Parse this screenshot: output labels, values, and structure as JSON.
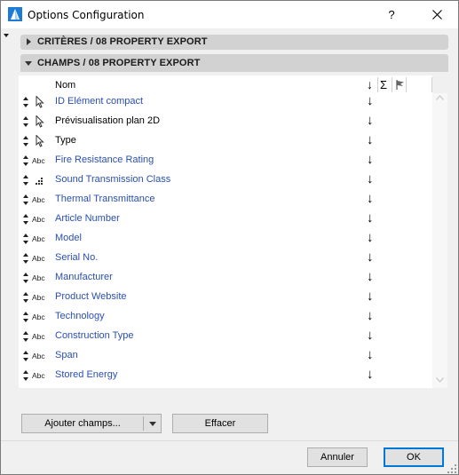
{
  "window": {
    "title": "Options Configuration",
    "help": "?"
  },
  "sections": {
    "criteria": "CRITÈRES / 08 PROPERTY EXPORT",
    "fields": "CHAMPS / 08 PROPERTY EXPORT"
  },
  "list": {
    "header_name": "Nom",
    "header_sort": "↓",
    "header_sum": "Σ",
    "rows": [
      {
        "type": "pointer",
        "name": "ID Elément compact",
        "color": "blue",
        "arrow": "↓"
      },
      {
        "type": "pointer",
        "name": "Prévisualisation plan 2D",
        "color": "black",
        "arrow": "↓"
      },
      {
        "type": "pointer",
        "name": "Type",
        "color": "black",
        "arrow": "↓"
      },
      {
        "type": "abc",
        "name": "Fire Resistance Rating",
        "color": "blue",
        "arrow": "↓"
      },
      {
        "type": "numeric",
        "name": "Sound Transmission Class",
        "color": "blue",
        "arrow": "↓"
      },
      {
        "type": "abc",
        "name": "Thermal Transmittance",
        "color": "blue",
        "arrow": "↓"
      },
      {
        "type": "abc",
        "name": "Article Number",
        "color": "blue",
        "arrow": "↓"
      },
      {
        "type": "abc",
        "name": "Model",
        "color": "blue",
        "arrow": "↓"
      },
      {
        "type": "abc",
        "name": "Serial No.",
        "color": "blue",
        "arrow": "↓"
      },
      {
        "type": "abc",
        "name": "Manufacturer",
        "color": "blue",
        "arrow": "↓"
      },
      {
        "type": "abc",
        "name": "Product Website",
        "color": "blue",
        "arrow": "↓"
      },
      {
        "type": "abc",
        "name": "Technology",
        "color": "blue",
        "arrow": "↓"
      },
      {
        "type": "abc",
        "name": "Construction Type",
        "color": "blue",
        "arrow": "↓"
      },
      {
        "type": "abc",
        "name": "Span",
        "color": "blue",
        "arrow": "↓"
      },
      {
        "type": "abc",
        "name": "Stored Energy",
        "color": "blue",
        "arrow": "↓"
      }
    ],
    "abc_label": "Abc"
  },
  "buttons": {
    "add_fields": "Ajouter champs...",
    "clear": "Effacer",
    "cancel": "Annuler",
    "ok": "OK"
  },
  "colors": {
    "field_blue": "#2a4fb3",
    "accent": "#0078d7"
  }
}
